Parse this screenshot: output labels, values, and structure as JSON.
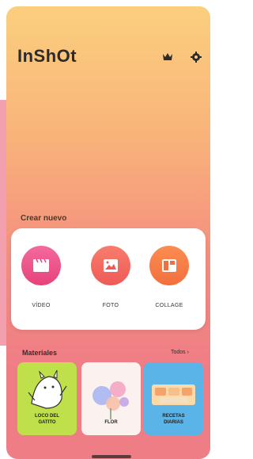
{
  "app": {
    "logo": "InShOt"
  },
  "header": {
    "icons": [
      "crown-icon",
      "gear-icon"
    ]
  },
  "create": {
    "title": "Crear nuevo",
    "tools": [
      {
        "label": "VÍDEO",
        "icon": "video-clapper-icon",
        "color": "#e7427c"
      },
      {
        "label": "FOTO",
        "icon": "photo-icon",
        "color": "#ee5b57"
      },
      {
        "label": "COLLAGE",
        "icon": "collage-icon",
        "color": "#f36f3d"
      }
    ]
  },
  "materials": {
    "title": "Materiales",
    "see_all": "Todos ›",
    "items": [
      {
        "label": "LOCO DEL\nGATITO",
        "color": "#bfe04a"
      },
      {
        "label": "FLOR",
        "color": "#fbf2ef"
      },
      {
        "label": "RECETAS\nDIARIAS",
        "color": "#5ab4e8"
      }
    ]
  }
}
